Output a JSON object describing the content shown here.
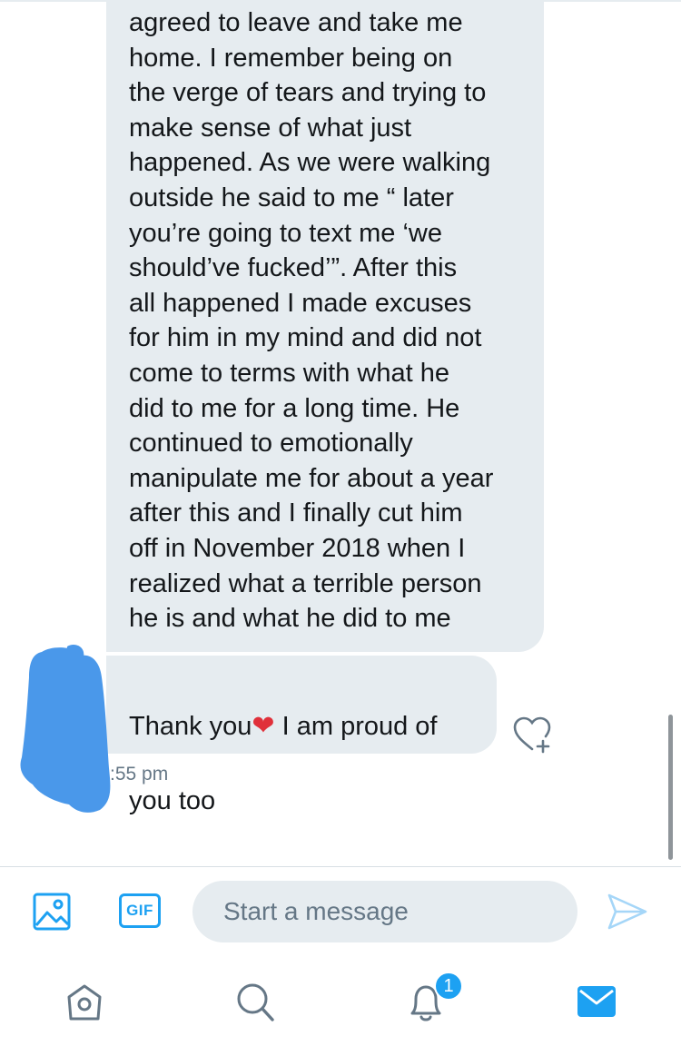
{
  "conversation": {
    "messages": [
      {
        "text": "agreed to leave and take me\nhome. I remember being on\nthe verge of tears and trying to\nmake sense of what just\nhappened. As we were walking\noutside he said to me “ later\nyou’re going to text me ‘we\nshould’ve fucked’”. After this\nall happened I made excuses\nfor him in my mind and did not\ncome to terms with what he\ndid to me for a long time. He\ncontinued to emotionally\nmanipulate me for about a year\nafter this and I finally cut him\noff in November 2018 when I\nrealized what a terrible person\nhe is and what he did to me"
      },
      {
        "text_before_emoji": "Thank you",
        "emoji": "❤",
        "text_after_emoji": " I am proud of",
        "text_line2": "you too"
      }
    ],
    "timestamp": ":55 pm"
  },
  "composer": {
    "placeholder": "Start a message",
    "gif_label": "GIF"
  },
  "icons": {
    "media": "image-icon",
    "gif": "gif-icon",
    "send": "send-icon",
    "like": "heart-plus-icon"
  },
  "tabbar": {
    "notifications_badge": "1"
  },
  "colors": {
    "accent": "#1da1f2",
    "bubble": "#e6ecf0",
    "muted_icon": "#657786",
    "redaction": "#4a98ea"
  }
}
